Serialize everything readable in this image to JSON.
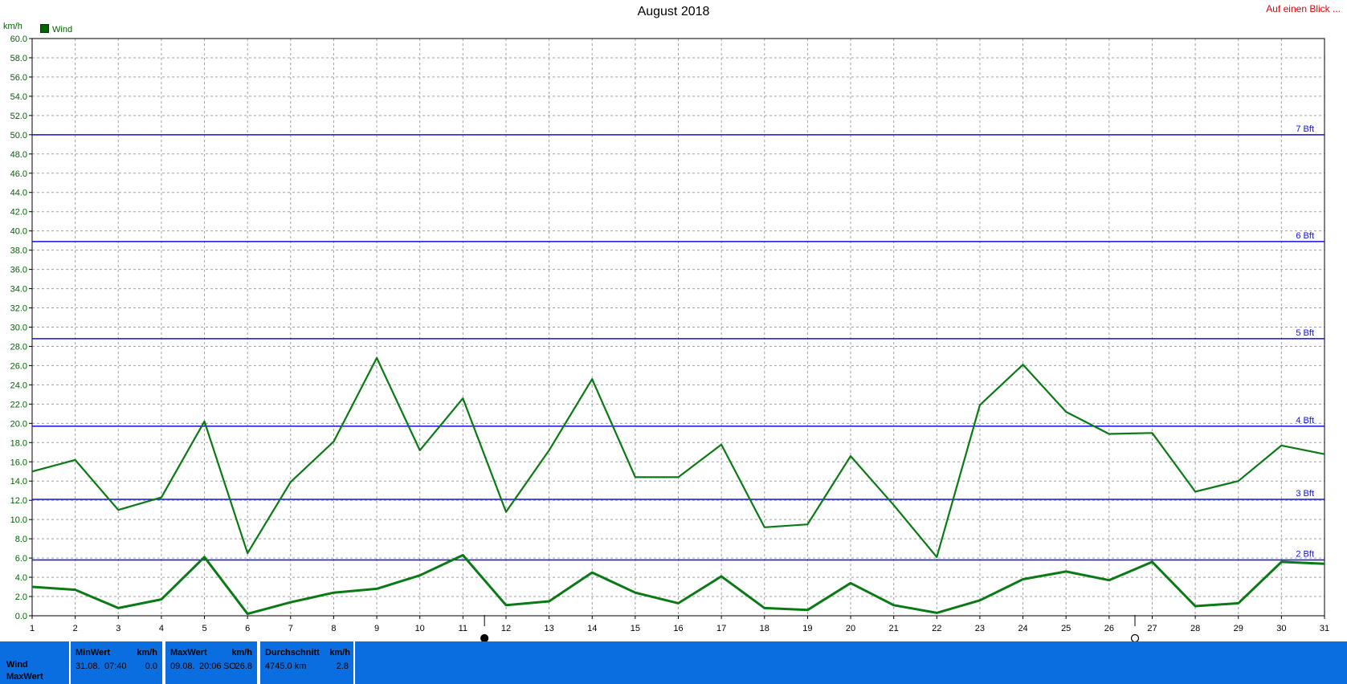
{
  "header": {
    "title": "August 2018",
    "overview_link": "Auf einen Blick ...",
    "unit": "km/h",
    "legend_label": "Wind"
  },
  "colors": {
    "series": "#0a7a14",
    "beaufort_lines": "#1010e0",
    "grid": "#a0a0a0",
    "link": "#e00000",
    "stats_bar": "#0a6ee0"
  },
  "icons": [
    "new-moon-icon",
    "full-moon-icon"
  ],
  "chart_data": {
    "type": "line",
    "title": "August 2018",
    "ylabel": "km/h",
    "ylim": [
      0,
      60
    ],
    "y_ticks": [
      "0.0",
      "2.0",
      "4.0",
      "6.0",
      "8.0",
      "10.0",
      "12.0",
      "14.0",
      "16.0",
      "18.0",
      "20.0",
      "22.0",
      "24.0",
      "26.0",
      "28.0",
      "30.0",
      "32.0",
      "34.0",
      "36.0",
      "38.0",
      "40.0",
      "42.0",
      "44.0",
      "46.0",
      "48.0",
      "50.0",
      "52.0",
      "54.0",
      "56.0",
      "58.0",
      "60.0"
    ],
    "x": [
      1,
      2,
      3,
      4,
      5,
      6,
      7,
      8,
      9,
      10,
      11,
      12,
      13,
      14,
      15,
      16,
      17,
      18,
      19,
      20,
      21,
      22,
      23,
      24,
      25,
      26,
      27,
      28,
      29,
      30,
      31
    ],
    "grid": true,
    "legend_position": "top-left",
    "series": [
      {
        "name": "Wind",
        "values": [
          15.0,
          16.2,
          11.0,
          12.3,
          20.2,
          6.5,
          13.9,
          18.1,
          26.8,
          17.2,
          22.6,
          10.8,
          17.2,
          24.6,
          14.4,
          14.4,
          17.8,
          9.2,
          9.5,
          16.6,
          11.5,
          6.1,
          21.9,
          26.1,
          21.2,
          18.9,
          19.0,
          12.9,
          14.0,
          17.7,
          16.8
        ]
      },
      {
        "values": [
          3.0,
          2.7,
          0.8,
          1.7,
          6.1,
          0.2,
          1.4,
          2.4,
          2.8,
          4.2,
          6.3,
          1.1,
          1.5,
          4.5,
          2.4,
          1.3,
          4.1,
          0.8,
          0.6,
          3.4,
          1.1,
          0.3,
          1.6,
          3.8,
          4.6,
          3.7,
          5.6,
          1.0,
          1.3,
          5.6,
          5.4
        ]
      }
    ],
    "reference_lines": [
      {
        "label": "2 Bft",
        "value": 5.8
      },
      {
        "label": "3 Bft",
        "value": 12.1
      },
      {
        "label": "4 Bft",
        "value": 19.7
      },
      {
        "label": "5 Bft",
        "value": 28.8
      },
      {
        "label": "6 Bft",
        "value": 38.9
      },
      {
        "label": "7 Bft",
        "value": 50.0
      }
    ],
    "moon_phases": [
      {
        "day": 11.5,
        "phase": "new-moon"
      },
      {
        "day": 26.6,
        "phase": "full-moon"
      }
    ]
  },
  "stats": {
    "row1_label": "Wind",
    "row2_label": "MaxWert",
    "min": {
      "header": "MinWert",
      "unit": "km/h",
      "date": "31.08.",
      "time": "07:40",
      "value": "0.0"
    },
    "max": {
      "header": "MaxWert",
      "unit": "km/h",
      "date": "09.08.",
      "time": "20:06",
      "dir": "SO",
      "value": "26.8"
    },
    "avg": {
      "header": "Durchschnitt",
      "unit": "km/h",
      "distance": "4745.0 km",
      "value": "2.8"
    }
  }
}
